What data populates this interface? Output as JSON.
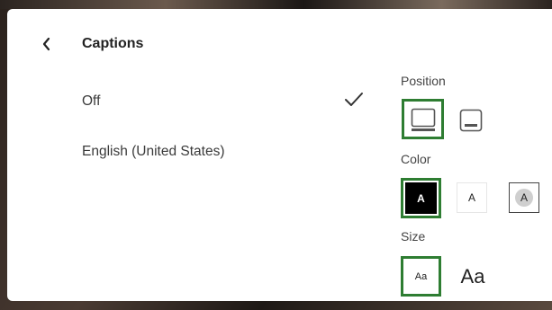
{
  "header": {
    "title": "Captions",
    "back_icon": "chevron-left-icon"
  },
  "caption_options": [
    {
      "label": "Off",
      "selected": true
    },
    {
      "label": "English (United States)",
      "selected": false
    }
  ],
  "position": {
    "label": "Position",
    "options": [
      {
        "name": "bottom",
        "icon": "caption-bottom-icon",
        "selected": true
      },
      {
        "name": "top",
        "icon": "caption-top-icon",
        "selected": false
      }
    ]
  },
  "color": {
    "label": "Color",
    "options": [
      {
        "name": "white-on-black",
        "text": "A",
        "selected": true
      },
      {
        "name": "black-on-white",
        "text": "A",
        "selected": false
      },
      {
        "name": "black-on-gray",
        "text": "A",
        "selected": false
      }
    ]
  },
  "size": {
    "label": "Size",
    "options": [
      {
        "name": "small",
        "text": "Aa",
        "selected": true
      },
      {
        "name": "large",
        "text": "Aa",
        "selected": false
      }
    ]
  },
  "colors": {
    "selection_border": "#2e7d32",
    "panel_bg": "#ffffff"
  }
}
